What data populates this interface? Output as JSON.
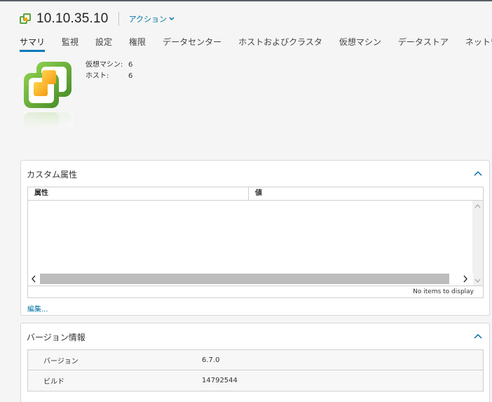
{
  "header": {
    "title": "10.10.35.10",
    "actions_label": "アクション"
  },
  "tabs": [
    {
      "label": "サマリ",
      "active": true
    },
    {
      "label": "監視"
    },
    {
      "label": "設定"
    },
    {
      "label": "権限"
    },
    {
      "label": "データセンター"
    },
    {
      "label": "ホストおよびクラスタ"
    },
    {
      "label": "仮想マシン"
    },
    {
      "label": "データストア"
    },
    {
      "label": "ネットワーク"
    }
  ],
  "summary": {
    "stats": [
      {
        "label": "仮想マシン:",
        "value": "6"
      },
      {
        "label": "ホスト:",
        "value": "6"
      }
    ]
  },
  "custom_attributes": {
    "title": "カスタム属性",
    "columns": [
      "属性",
      "値"
    ],
    "rows": [],
    "footer": "No items to display",
    "edit_label": "編集..."
  },
  "version_info": {
    "title": "バージョン情報",
    "rows": [
      {
        "key": "バージョン",
        "value": "6.7.0"
      },
      {
        "key": "ビルド",
        "value": "14792544"
      }
    ]
  },
  "colors": {
    "accent": "#0079b8",
    "link": "#0072a3",
    "vcenter_green": "#5aa33b",
    "vcenter_orange": "#f3a612"
  },
  "icons": {
    "header": "vcenter-icon",
    "actions": "chevron-down-icon",
    "logo": "vcenter-logo",
    "collapse": "chevron-up-icon"
  }
}
